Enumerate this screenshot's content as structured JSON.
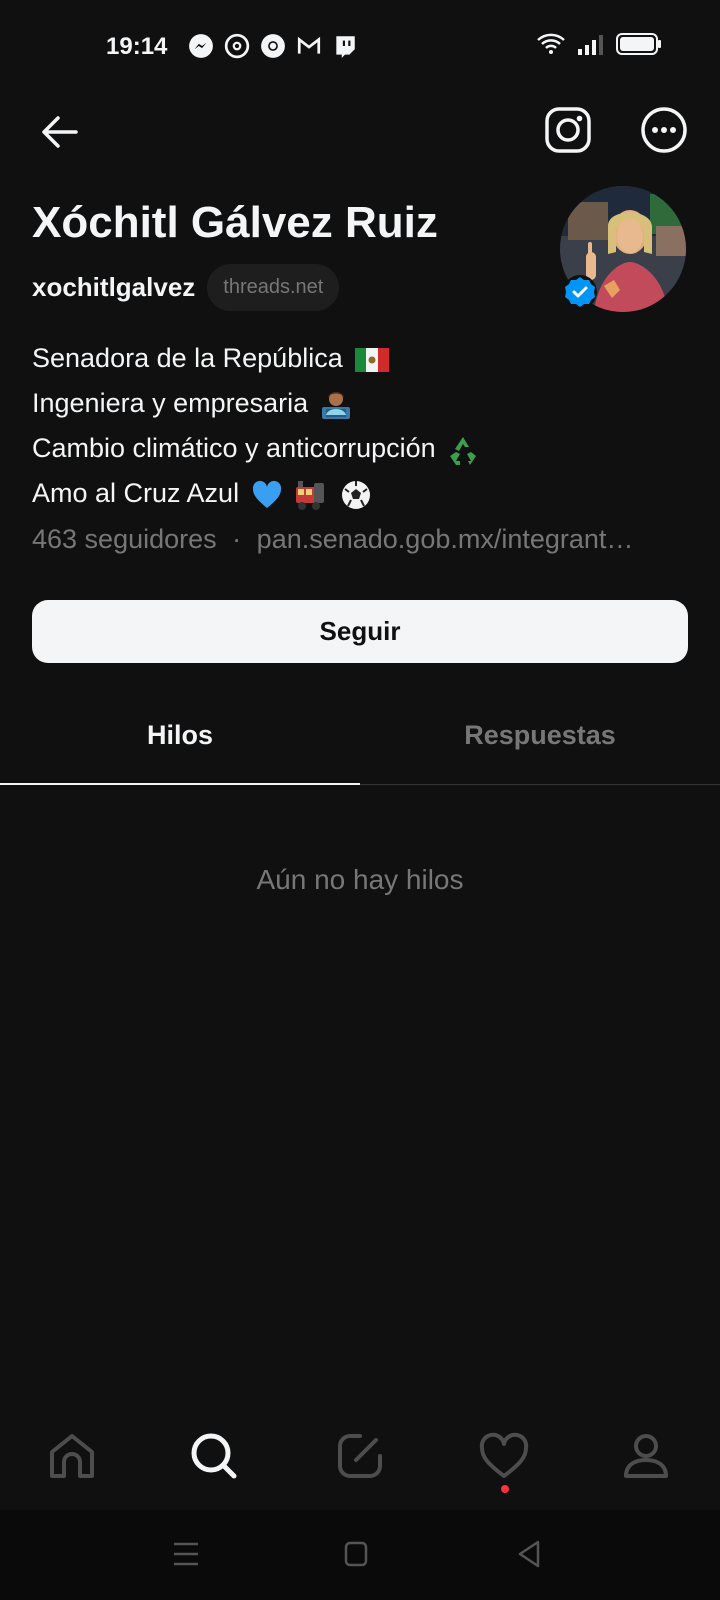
{
  "status_bar": {
    "time": "19:14",
    "notification_icons": [
      "messenger-icon",
      "threads-icon",
      "chrome-icon",
      "gmail-icon",
      "twitch-icon"
    ],
    "system_icons": [
      "wifi-icon",
      "signal-icon",
      "battery-icon"
    ]
  },
  "top_bar": {
    "icons": [
      "back-arrow-icon",
      "instagram-icon",
      "more-icon"
    ]
  },
  "profile": {
    "name": "Xóchitl Gálvez Ruiz",
    "handle": "xochitlgalvez",
    "domain": "threads.net",
    "verified": true,
    "bio": [
      {
        "text": "Senadora de la República",
        "emoji": "mexico-flag"
      },
      {
        "text": "Ingeniera y empresaria",
        "emoji": "technologist"
      },
      {
        "text": "Cambio climático y anticorrupción",
        "emoji": "recycling"
      },
      {
        "text": "Amo al Cruz Azul",
        "emoji": "blue-heart train soccer-ball"
      }
    ],
    "followers": "463 seguidores",
    "separator": "·",
    "link": "pan.senado.gob.mx/integrant…"
  },
  "follow_button": {
    "label": "Seguir"
  },
  "tabs": [
    {
      "label": "Hilos",
      "active": true
    },
    {
      "label": "Respuestas",
      "active": false
    }
  ],
  "empty_state": {
    "text": "Aún no hay hilos"
  },
  "bottom_nav": {
    "items": [
      "home-icon",
      "search-icon",
      "compose-icon",
      "activity-heart-icon",
      "profile-icon"
    ],
    "active": "search-icon",
    "notification_color": "#ff3040"
  },
  "system_nav": [
    "menu-icon",
    "home-square-icon",
    "back-triangle-icon"
  ],
  "colors": {
    "background": "#101010",
    "text_primary": "#f3f5f7",
    "text_secondary": "#777777",
    "verified_blue": "#0095f6"
  }
}
